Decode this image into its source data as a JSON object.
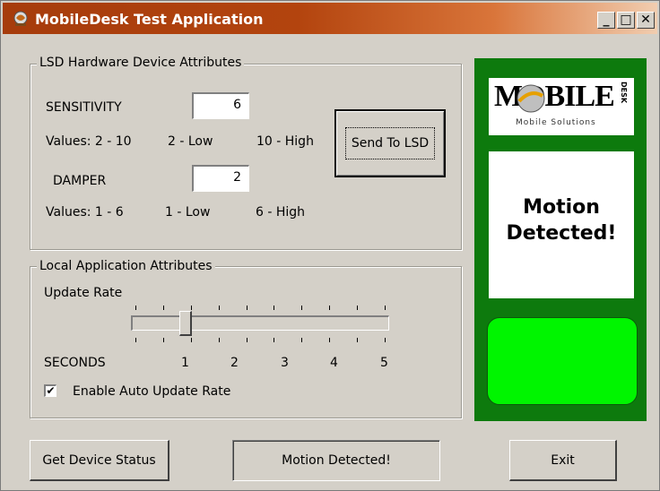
{
  "window": {
    "title": "MobileDesk Test Application",
    "controls": {
      "minimize": "_",
      "maximize": "□",
      "close": "✕"
    }
  },
  "lsd_group": {
    "legend": "LSD Hardware Device Attributes",
    "sensitivity": {
      "label": "SENSITIVITY",
      "value": "6",
      "values_label": "Values:  2 - 10",
      "low_label": "2 - Low",
      "high_label": "10 - High"
    },
    "damper": {
      "label": "DAMPER",
      "value": "2",
      "values_label": "Values:  1 - 6",
      "low_label": "1 - Low",
      "high_label": "6 - High"
    },
    "send_button": "Send To LSD"
  },
  "local_group": {
    "legend": "Local Application Attributes",
    "update_rate_label": "Update Rate",
    "slider": {
      "min": 0,
      "max": 5,
      "value": 1,
      "unit_label": "SECONDS",
      "tick_labels": [
        "1",
        "2",
        "3",
        "4",
        "5"
      ]
    },
    "auto_update": {
      "label": "Enable Auto Update Rate",
      "checked": true,
      "mark": "✔"
    }
  },
  "brand": {
    "logo_text": "MOBILE",
    "logo_suffix": "DESK",
    "logo_tagline": "Mobile Solutions"
  },
  "motion_panel": {
    "line1": "Motion",
    "line2": "Detected!"
  },
  "bottom": {
    "get_status_button": "Get Device Status",
    "status_text": "Motion Detected!",
    "exit_button": "Exit"
  },
  "colors": {
    "titlebar": "#b3440e",
    "panel_green": "#0d7a0d",
    "indicator_green": "#00f500",
    "window_bg": "#d4d0c8"
  },
  "icons": [
    "app-icon",
    "minimize-icon",
    "maximize-icon",
    "close-icon",
    "check-icon"
  ]
}
